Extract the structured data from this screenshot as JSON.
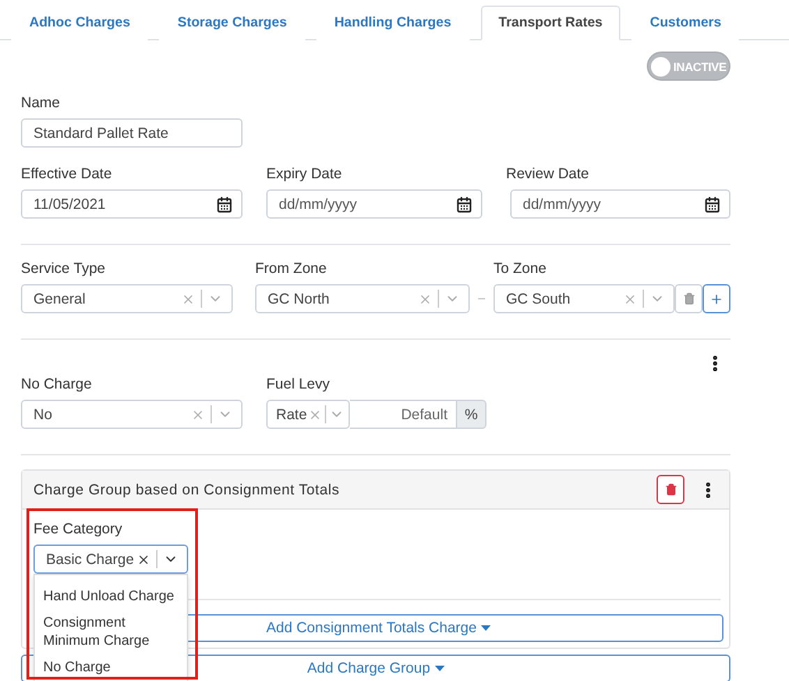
{
  "tabs": [
    {
      "label": "Adhoc Charges",
      "selected": false
    },
    {
      "label": "Storage Charges",
      "selected": false
    },
    {
      "label": "Handling Charges",
      "selected": false
    },
    {
      "label": "Transport Rates",
      "selected": true
    },
    {
      "label": "Customers",
      "selected": false
    }
  ],
  "status_toggle": {
    "label": "INACTIVE",
    "on": false
  },
  "name": {
    "label": "Name",
    "value": "Standard Pallet Rate"
  },
  "dates": [
    {
      "label": "Effective Date",
      "value": "11/05/2021"
    },
    {
      "label": "Expiry Date",
      "placeholder": "dd/mm/yyyy"
    },
    {
      "label": "Review Date",
      "placeholder": "dd/mm/yyyy"
    }
  ],
  "service_type": {
    "label": "Service Type",
    "value": "General"
  },
  "from_zone": {
    "label": "From Zone",
    "value": "GC North"
  },
  "to_zone": {
    "label": "To Zone",
    "value": "GC South"
  },
  "no_charge": {
    "label": "No Charge",
    "value": "No"
  },
  "fuel_levy": {
    "label": "Fuel Levy",
    "type": "Rate",
    "placeholder": "Default",
    "unit": "%"
  },
  "charge_group": {
    "title": "Charge Group based on Consignment Totals",
    "fee_category": {
      "label": "Fee Category",
      "value": "Basic Charge",
      "expanded": true,
      "options": [
        {
          "label": "Hand Unload Charge",
          "selected": false
        },
        {
          "label": "Consignment Minimum Charge",
          "selected": false
        },
        {
          "label": "No Charge",
          "selected": false
        }
      ]
    },
    "add_button": "Add Consignment Totals Charge"
  },
  "add_group_button": "Add Charge Group"
}
